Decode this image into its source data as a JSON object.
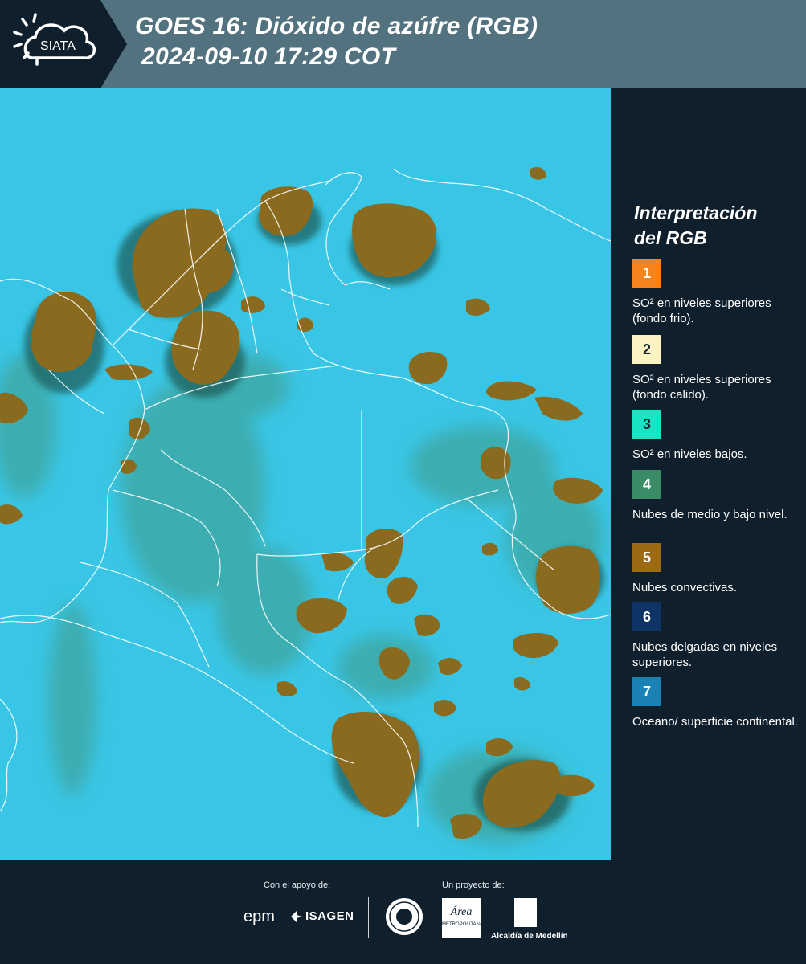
{
  "header": {
    "logo_text": "SIATA",
    "title_line1": "GOES 16: Dióxido de azúfre (RGB)",
    "title_line2": "2024-09-10 17:29 COT"
  },
  "map": {
    "background_color": "#39c6e6",
    "convective_cloud_color": "#8a6a1e",
    "low_cloud_color": "#3f9a85",
    "border_color": "#ffffff"
  },
  "legend": {
    "title_line1": "Interpretación",
    "title_line2": "del RGB",
    "items": [
      {
        "number": "1",
        "color": "#f5841f",
        "text_color": "#ffffff",
        "text": "SO² en niveles superiores (fondo frio)."
      },
      {
        "number": "2",
        "color": "#fbf4c2",
        "text_color": "#1c2a36",
        "text": "SO² en niveles superiores (fondo calido)."
      },
      {
        "number": "3",
        "color": "#19e5c4",
        "text_color": "#1c2a36",
        "text": "SO² en niveles bajos."
      },
      {
        "number": "4",
        "color": "#3a8c66",
        "text_color": "#ffffff",
        "text": "Nubes de medio y bajo nivel."
      },
      {
        "number": "5",
        "color": "#9b6a13",
        "text_color": "#ffffff",
        "text": "Nubes convectivas."
      },
      {
        "number": "6",
        "color": "#0e3466",
        "text_color": "#ffffff",
        "text": "Nubes delgadas en niveles superiores."
      },
      {
        "number": "7",
        "color": "#1a82b4",
        "text_color": "#ffffff",
        "text": "Oceano/ superficie continental."
      }
    ]
  },
  "footer": {
    "support_caption": "Con el apoyo de:",
    "project_caption": "Un proyecto de:",
    "epm_label": "epm",
    "isagen_label": "ISAGEN",
    "area_label": "Área",
    "area_sublabel": "METROPOLITANA",
    "alcaldia_label": "Alcaldía de Medellín"
  }
}
